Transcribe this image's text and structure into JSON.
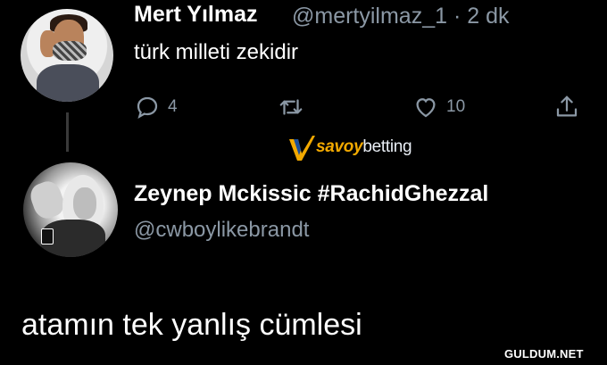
{
  "tweet1": {
    "name": "Mert Yılmaz",
    "meta": "@mertyilmaz_1 · 2 dk",
    "text": "türk milleti zekidir",
    "reply_count": "4",
    "like_count": "10"
  },
  "watermark": {
    "text_a": "savoy",
    "text_b": "betting",
    "accent": "#f2a900"
  },
  "tweet2": {
    "name": "Zeynep Mckissic #RachidGhezzal",
    "handle": "@cwboylikebrandt",
    "text": "atamın tek yanlış cümlesi"
  },
  "site": "GULDUM.NET",
  "icons": [
    "reply-icon",
    "retweet-icon",
    "like-icon",
    "share-icon"
  ],
  "colors": {
    "background": "#000000",
    "text": "#ffffff",
    "muted": "#8b98a5"
  }
}
